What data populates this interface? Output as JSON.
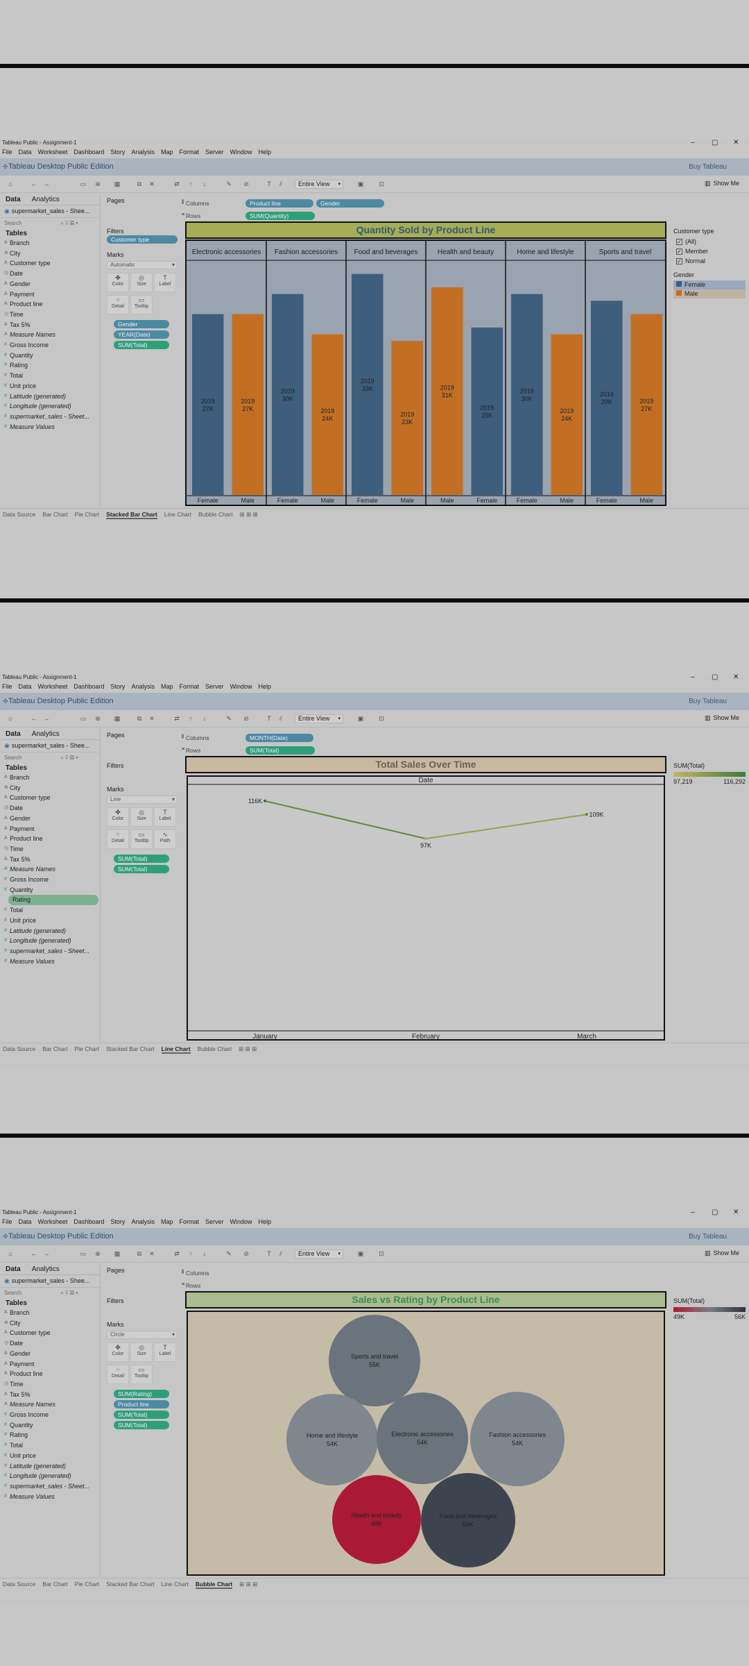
{
  "window_title": "Tableau Public - Assignment-1",
  "menu": [
    "File",
    "Data",
    "Worksheet",
    "Dashboard",
    "Story",
    "Analysis",
    "Map",
    "Format",
    "Server",
    "Window",
    "Help"
  ],
  "app_name": "Tableau Desktop Public Edition",
  "buy_label": "Buy Tableau",
  "fit_select": "Entire View",
  "show_me": "Show Me",
  "tab_data": "Data",
  "tab_analytics": "Analytics",
  "data_source_bar": "supermarket_sales - Shee...",
  "data_source_panel": "supermarket_sales - Sheet...",
  "search_placeholder": "Search",
  "tables_label": "Tables",
  "dim_fields": [
    "Branch",
    "City",
    "Customer type",
    "Date",
    "Gender",
    "Payment",
    "Product line",
    "Time",
    "Tax 5%",
    "Measure Names"
  ],
  "measure_fields": [
    "Gross Income",
    "Quantity",
    "Rating",
    "Total",
    "Unit price",
    "Latitude (generated)",
    "Longitude (generated)",
    "supermarket_sales - Sheet...",
    "Measure Values"
  ],
  "pages_label": "Pages",
  "filters_label": "Filters",
  "marks_label": "Marks",
  "columns_label": "Columns",
  "rows_label": "Rows",
  "mark_buttons": {
    "color": "Color",
    "size": "Size",
    "label": "Label",
    "detail": "Detail",
    "tooltip": "Tooltip",
    "path": "Path"
  },
  "sheet_tabs": [
    "Data Source",
    "Bar Chart",
    "Pie Chart",
    "Stacked Bar Chart",
    "Line Chart",
    "Bubble Chart"
  ],
  "colors": {
    "female": "#3e5e7e",
    "male": "#c26f24",
    "bubble_red": "#aa1a35",
    "bubble_dark": "#3d434f",
    "bubble_mid": "#6b737c",
    "bubble_light": "#7f868e"
  },
  "panel1": {
    "columns_pills": [
      "Product line",
      "Gender"
    ],
    "rows_pills": [
      "SUM(Quantity)"
    ],
    "filter_pill": "Customer type",
    "marks_type": "Automatic",
    "marks_pills": [
      "Gender",
      "YEAR(Date)",
      "SUM(Total)"
    ],
    "title": "Quantity Sold by Product Line",
    "legend_customer_title": "Customer type",
    "legend_customer": [
      "(All)",
      "Member",
      "Normal"
    ],
    "legend_gender_title": "Gender",
    "legend_gender": [
      "Female",
      "Male"
    ],
    "active_tab": "Stacked Bar Chart"
  },
  "panel2": {
    "columns_pills": [
      "MONTH(Date)"
    ],
    "rows_pills": [
      "SUM(Total)"
    ],
    "marks_type": "Line",
    "marks_pills": [
      "SUM(Total)",
      "SUM(Total)"
    ],
    "title": "Total Sales Over Time",
    "header": "Date",
    "legend_title": "SUM(Total)",
    "legend_min": "97,219",
    "legend_max": "116,292",
    "highlight_field": "Rating",
    "active_tab": "Line Chart"
  },
  "panel3": {
    "marks_type": "Circle",
    "marks_pills": [
      "SUM(Rating)",
      "Product line",
      "SUM(Total)",
      "SUM(Total)"
    ],
    "title": "Sales vs Rating by Product Line",
    "legend_title": "SUM(Total)",
    "legend_min": "49K",
    "legend_max": "56K",
    "active_tab": "Bubble Chart"
  },
  "chart_data": [
    {
      "type": "bar",
      "title": "Quantity Sold by Product Line",
      "categories": [
        "Electronic accessories",
        "Fashion accessories",
        "Food and beverages",
        "Health and beauty",
        "Home and lifestyle",
        "Sports and travel"
      ],
      "bars": [
        [
          {
            "g": "Female",
            "year": "2019",
            "label": "27K",
            "value": 27
          },
          {
            "g": "Male",
            "year": "2019",
            "label": "27K",
            "value": 27
          }
        ],
        [
          {
            "g": "Female",
            "year": "2019",
            "label": "30K",
            "value": 30
          },
          {
            "g": "Male",
            "year": "2019",
            "label": "24K",
            "value": 24
          }
        ],
        [
          {
            "g": "Female",
            "year": "2019",
            "label": "33K",
            "value": 33
          },
          {
            "g": "Male",
            "year": "2019",
            "label": "23K",
            "value": 23
          }
        ],
        [
          {
            "g": "Male",
            "year": "2019",
            "label": "31K",
            "value": 31
          },
          {
            "g": "Female",
            "year": "2019",
            "label": "25K",
            "value": 25
          }
        ],
        [
          {
            "g": "Female",
            "year": "2019",
            "label": "30K",
            "value": 30
          },
          {
            "g": "Male",
            "year": "2019",
            "label": "24K",
            "value": 24
          }
        ],
        [
          {
            "g": "Female",
            "year": "2019",
            "label": "29K",
            "value": 29
          },
          {
            "g": "Male",
            "year": "2019",
            "label": "27K",
            "value": 27
          }
        ]
      ],
      "ylim": [
        0,
        34
      ]
    },
    {
      "type": "line",
      "title": "Total Sales Over Time",
      "x": [
        "January",
        "February",
        "March"
      ],
      "labels": [
        "116K",
        "97K",
        "109K"
      ],
      "values": [
        116292,
        97219,
        109456
      ],
      "ylim": [
        0,
        125000
      ]
    },
    {
      "type": "scatter",
      "title": "Sales vs Rating by Product Line",
      "points": [
        {
          "name": "Sports and travel",
          "label": "55K",
          "color": "bubble_mid"
        },
        {
          "name": "Home and lifestyle",
          "label": "54K",
          "color": "bubble_light"
        },
        {
          "name": "Electronic accessories",
          "label": "54K",
          "color": "bubble_mid"
        },
        {
          "name": "Fashion accessories",
          "label": "54K",
          "color": "bubble_light"
        },
        {
          "name": "Health and beauty",
          "label": "49K",
          "color": "bubble_red"
        },
        {
          "name": "Food and beverages",
          "label": "56K",
          "color": "bubble_dark"
        }
      ]
    }
  ]
}
